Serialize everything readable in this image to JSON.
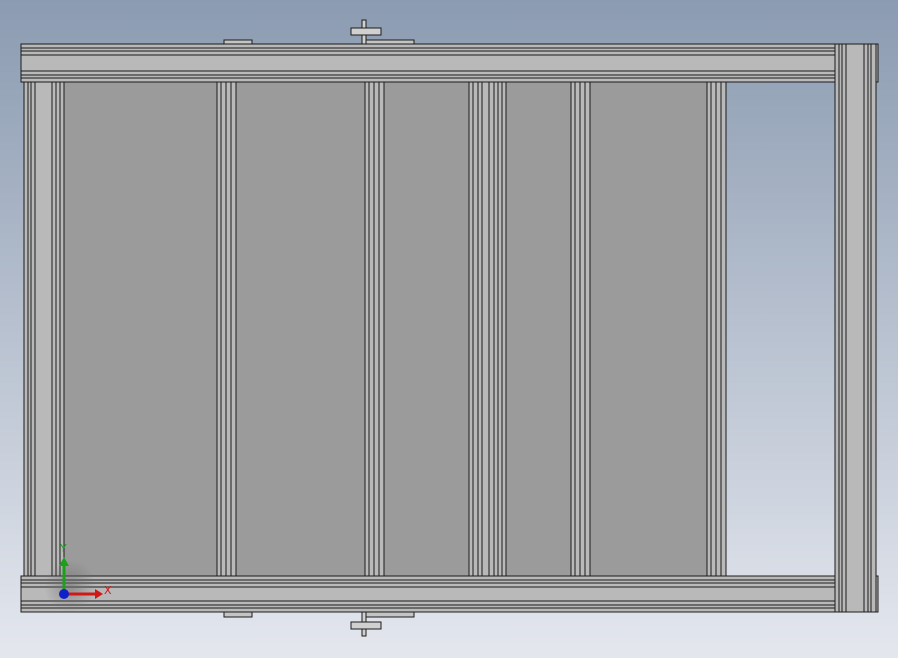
{
  "viewport": {
    "background_top": "#8b9bb1",
    "background_bottom": "#e4e7ee",
    "panel_color": "#9b9b9b",
    "frame_color": "#b9b9b9",
    "edge_color": "#1c1c1c"
  },
  "triad": {
    "x_label": "X",
    "y_label": "Y",
    "x_color": "#d01818",
    "y_color": "#1ca01c",
    "z_color": "#1020c8"
  }
}
